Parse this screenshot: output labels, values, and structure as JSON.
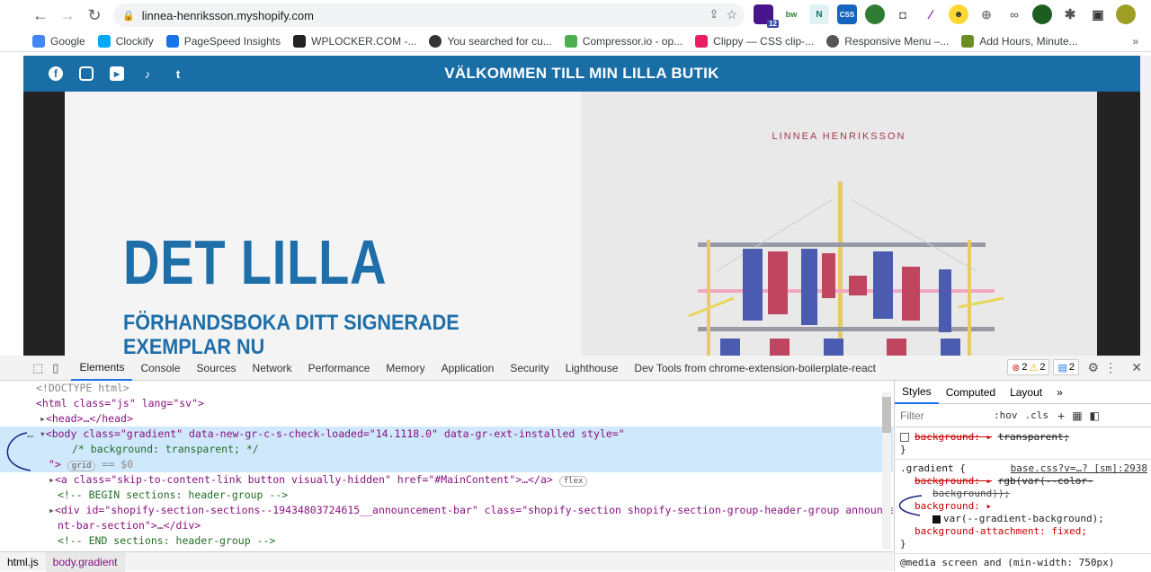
{
  "browser": {
    "url": "linnea-henriksson.myshopify.com",
    "ext_badge": "12"
  },
  "bookmarks": [
    {
      "label": "Google",
      "color": "#4285f4"
    },
    {
      "label": "Clockify",
      "color": "#03a9f4"
    },
    {
      "label": "PageSpeed Insights",
      "color": "#1a73e8"
    },
    {
      "label": "WPLOCKER.COM -...",
      "color": "#222222"
    },
    {
      "label": "You searched for cu...",
      "color": "#333333"
    },
    {
      "label": "Compressor.io - op...",
      "color": "#4caf50"
    },
    {
      "label": "Clippy — CSS clip-...",
      "color": "#e91e63"
    },
    {
      "label": "Responsive Menu –...",
      "color": "#555555"
    },
    {
      "label": "Add Hours, Minute...",
      "color": "#6b8e23"
    }
  ],
  "page": {
    "announcement": "VÄLKOMMEN TILL MIN LILLA BUTIK",
    "author": "LINNEA HENRIKSSON",
    "hero_title": "DET LILLA",
    "hero_subtitle": "FÖRHANDSBOKA DITT SIGNERADE EXEMPLAR NU",
    "accent": "#1a6ea6"
  },
  "devtools": {
    "tabs": [
      "Elements",
      "Console",
      "Sources",
      "Network",
      "Performance",
      "Memory",
      "Application",
      "Security",
      "Lighthouse",
      "Dev Tools from chrome-extension-boilerplate-react"
    ],
    "errors": "2",
    "warnings": "2",
    "messages": "2",
    "elements": {
      "doctype": "<!DOCTYPE html>",
      "html_line": "<html class=\"js\" lang=\"sv\">",
      "head_line": "<head>…</head>",
      "body_open": "<body class=\"gradient\" data-new-gr-c-s-check-loaded=\"14.1118.0\" data-gr-ext-installed style=\"",
      "body_comment": "/* background: transparent; */",
      "body_close": "\">",
      "body_grid": "grid",
      "body_eq": "== $0",
      "skip_link": "<a class=\"skip-to-content-link button visually-hidden\" href=\"#MainContent\">…</a>",
      "skip_flex": "flex",
      "comment_begin": "<!-- BEGIN sections: header-group -->",
      "section_div": "<div id=\"shopify-section-sections--19434803724615__announcement-bar\" class=\"shopify-section shopify-section-group-header-group announceme",
      "section_div2": "nt-bar-section\">…</div>",
      "comment_end": "<!-- END sections: header-group -->"
    },
    "styles": {
      "tabs": [
        "Styles",
        "Computed",
        "Layout"
      ],
      "filter_placeholder": "Filter",
      "hov": ":hov",
      "cls": ".cls",
      "rule1_prop": "background: ▸",
      "rule1_val": "transparent;",
      "selector": ".gradient {",
      "source": "base.css?v=…? [sm]:2938",
      "rule2_prop": "background: ▸",
      "rule2_val": "rgb(var(--color-",
      "rule2_val2": "background));",
      "rule3_prop": "background: ▸",
      "rule3_val": "var(--gradient-background);",
      "rule4": "background-attachment: fixed;",
      "close": "}",
      "media": "@media screen and (min-width: 750px)"
    },
    "breadcrumbs": [
      "html.js",
      "body.gradient"
    ]
  }
}
